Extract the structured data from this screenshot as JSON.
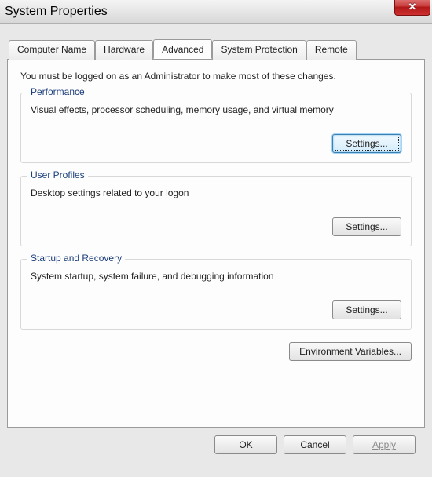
{
  "window": {
    "title": "System Properties",
    "close_icon": "✕"
  },
  "tabs": {
    "computer_name": "Computer Name",
    "hardware": "Hardware",
    "advanced": "Advanced",
    "system_protection": "System Protection",
    "remote": "Remote"
  },
  "panel": {
    "intro": "You must be logged on as an Administrator to make most of these changes.",
    "performance": {
      "legend": "Performance",
      "desc": "Visual effects, processor scheduling, memory usage, and virtual memory",
      "settings": "Settings..."
    },
    "user_profiles": {
      "legend": "User Profiles",
      "desc": "Desktop settings related to your logon",
      "settings": "Settings..."
    },
    "startup": {
      "legend": "Startup and Recovery",
      "desc": "System startup, system failure, and debugging information",
      "settings": "Settings..."
    },
    "env_vars": "Environment Variables..."
  },
  "buttons": {
    "ok": "OK",
    "cancel": "Cancel",
    "apply": "Apply"
  }
}
